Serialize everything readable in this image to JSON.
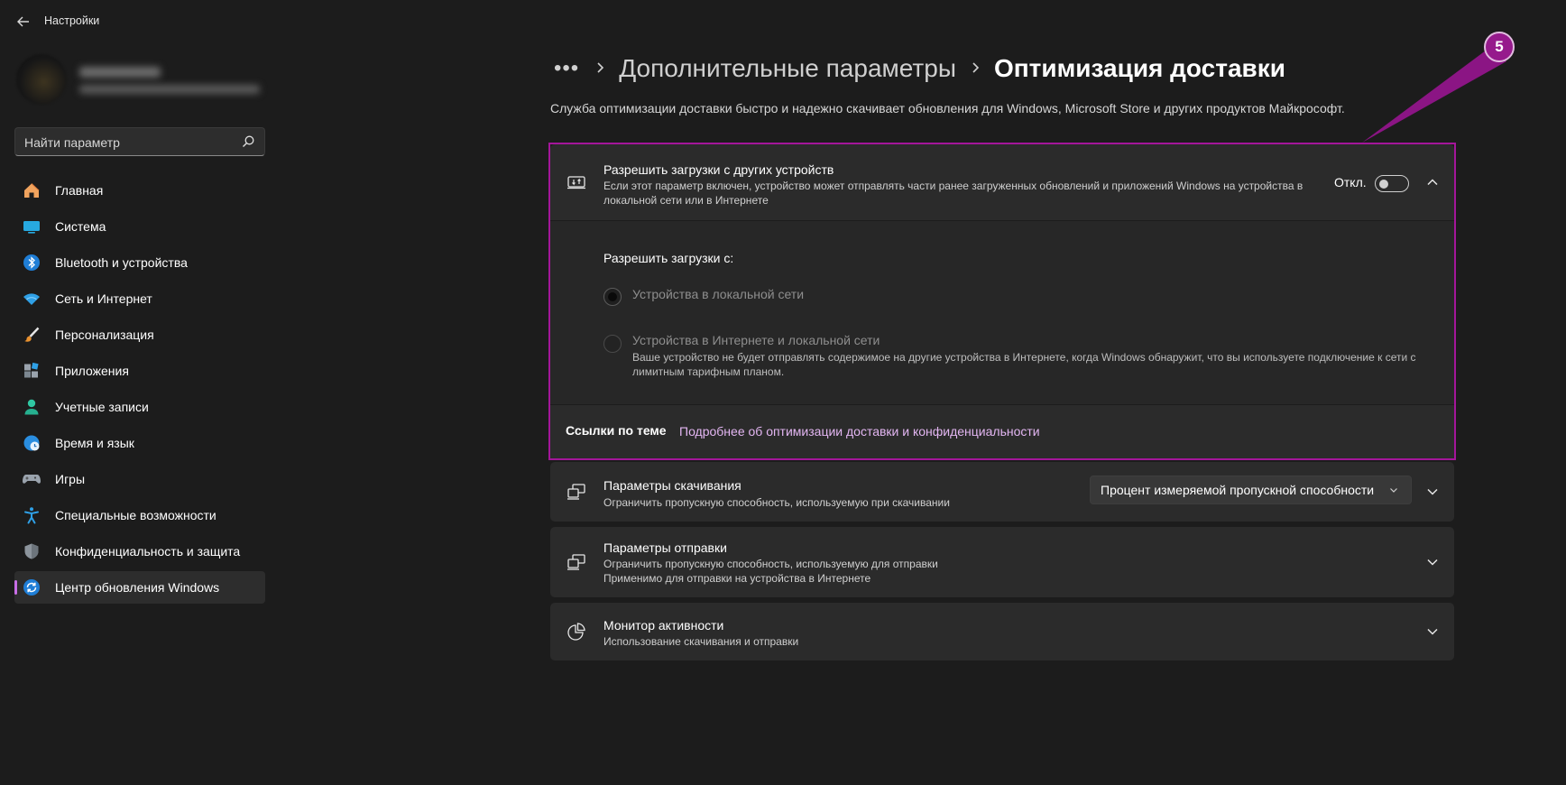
{
  "window": {
    "title": "Настройки"
  },
  "search": {
    "placeholder": "Найти параметр"
  },
  "sidebar": {
    "items": [
      {
        "label": "Главная",
        "icon": "home-icon"
      },
      {
        "label": "Система",
        "icon": "system-icon"
      },
      {
        "label": "Bluetooth и устройства",
        "icon": "bluetooth-icon"
      },
      {
        "label": "Сеть и Интернет",
        "icon": "wifi-icon"
      },
      {
        "label": "Персонализация",
        "icon": "brush-icon"
      },
      {
        "label": "Приложения",
        "icon": "apps-icon"
      },
      {
        "label": "Учетные записи",
        "icon": "account-icon"
      },
      {
        "label": "Время и язык",
        "icon": "globe-clock-icon"
      },
      {
        "label": "Игры",
        "icon": "gamepad-icon"
      },
      {
        "label": "Специальные возможности",
        "icon": "accessibility-icon"
      },
      {
        "label": "Конфиденциальность и защита",
        "icon": "shield-icon"
      },
      {
        "label": "Центр обновления Windows",
        "icon": "update-icon",
        "active": true
      }
    ]
  },
  "breadcrumb": {
    "dots": "•••",
    "parent": "Дополнительные параметры",
    "current": "Оптимизация доставки"
  },
  "description": "Служба оптимизации доставки быстро и надежно скачивает обновления для Windows, Microsoft Store и других продуктов Майкрософт.",
  "allow_downloads": {
    "title": "Разрешить загрузки с других устройств",
    "subtitle_line1": "Если этот параметр включен, устройство может отправлять части ранее загруженных обновлений и приложений Windows на устройства в",
    "subtitle_line2": "локальной сети или в Интернете",
    "toggle_state": "Откл.",
    "toggle_on": false,
    "expanded": true,
    "from_label": "Разрешить загрузки с:",
    "options": [
      {
        "label": "Устройства в локальной сети",
        "selected": true
      },
      {
        "label": "Устройства в Интернете и локальной сети",
        "selected": false,
        "note_line1": "Ваше устройство не будет отправлять содержимое на другие устройства в Интернете, когда Windows обнаружит, что вы используете подключение к сети с",
        "note_line2": "лимитным тарифным планом."
      }
    ]
  },
  "related": {
    "label": "Ссылки по теме",
    "link": "Подробнее об оптимизации доставки и конфиденциальности"
  },
  "download_settings": {
    "title": "Параметры скачивания",
    "subtitle": "Ограничить пропускную способность, используемую при скачивании",
    "dropdown_value": "Процент измеряемой пропускной способности"
  },
  "upload_settings": {
    "title": "Параметры отправки",
    "subtitle_line1": "Ограничить пропускную способность, используемую для отправки",
    "subtitle_line2": "Применимо для отправки на устройства в Интернете"
  },
  "activity_monitor": {
    "title": "Монитор активности",
    "subtitle": "Использование скачивания и отправки"
  },
  "annotation": {
    "number": "5",
    "color": "#961a8c"
  },
  "colors": {
    "accent": "#c86ee6",
    "highlight": "#a4169a",
    "background": "#1c1c1c",
    "card": "#2b2b2b",
    "link": "#e3b6f2"
  }
}
